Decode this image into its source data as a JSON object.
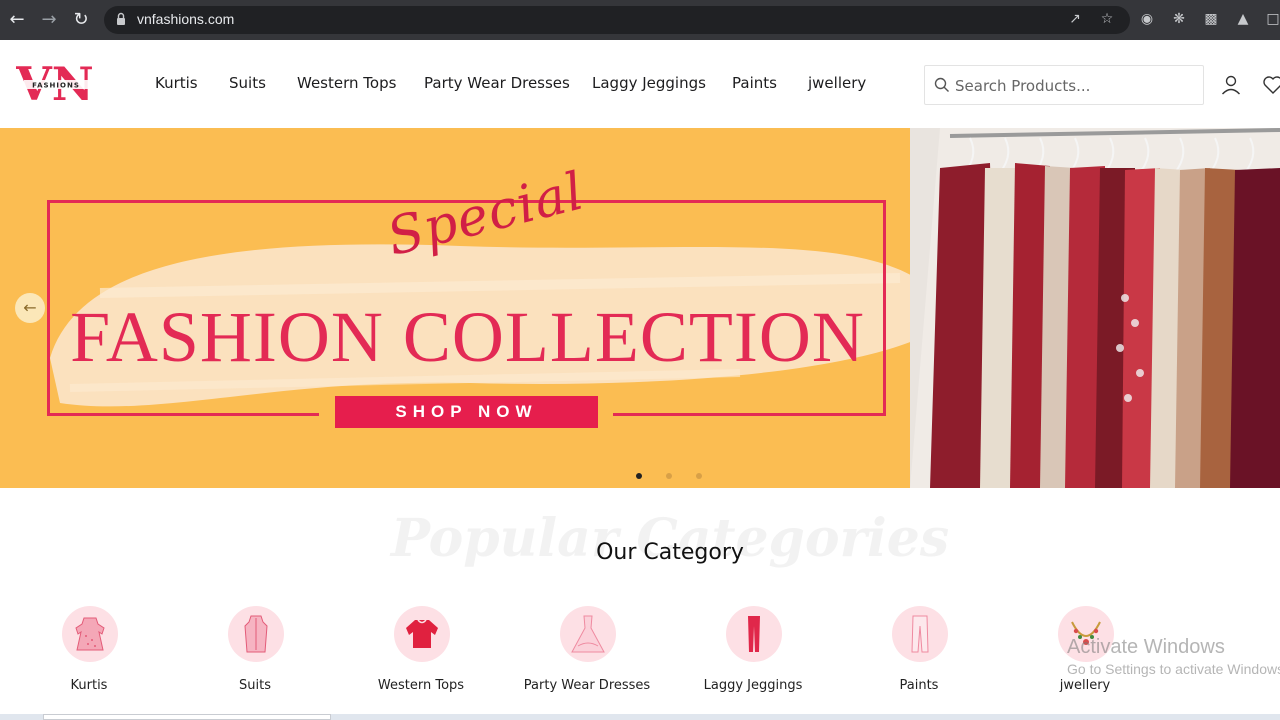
{
  "browser": {
    "url": "vnfashions.com"
  },
  "header": {
    "logo_letters": "VN",
    "logo_sub": "FASHIONS",
    "nav": [
      "Kurtis",
      "Suits",
      "Western Tops",
      "Party Wear Dresses",
      "Laggy Jeggings",
      "Paints",
      "jwellery"
    ],
    "search_placeholder": "Search Products..."
  },
  "hero": {
    "script_text": "Special",
    "headline": "FASHION COLLECTION",
    "cta": "SHOP NOW",
    "slides": 3,
    "active_slide": 0
  },
  "categories": {
    "background_title": "Popular Categories",
    "title": "Our Category",
    "items": [
      {
        "label": "Kurtis",
        "icon": "kurti-icon"
      },
      {
        "label": "Suits",
        "icon": "suit-icon"
      },
      {
        "label": "Western Tops",
        "icon": "top-icon"
      },
      {
        "label": "Party Wear Dresses",
        "icon": "gown-icon"
      },
      {
        "label": "Laggy Jeggings",
        "icon": "leggings-icon"
      },
      {
        "label": "Paints",
        "icon": "pants-icon"
      },
      {
        "label": "jwellery",
        "icon": "necklace-icon"
      }
    ]
  },
  "watermark": {
    "line1": "Activate Windows",
    "line2": "Go to Settings to activate Windows."
  },
  "colors": {
    "accent": "#e32a55",
    "banner_bg": "#fbbd52",
    "category_circle": "#fde0e5"
  }
}
